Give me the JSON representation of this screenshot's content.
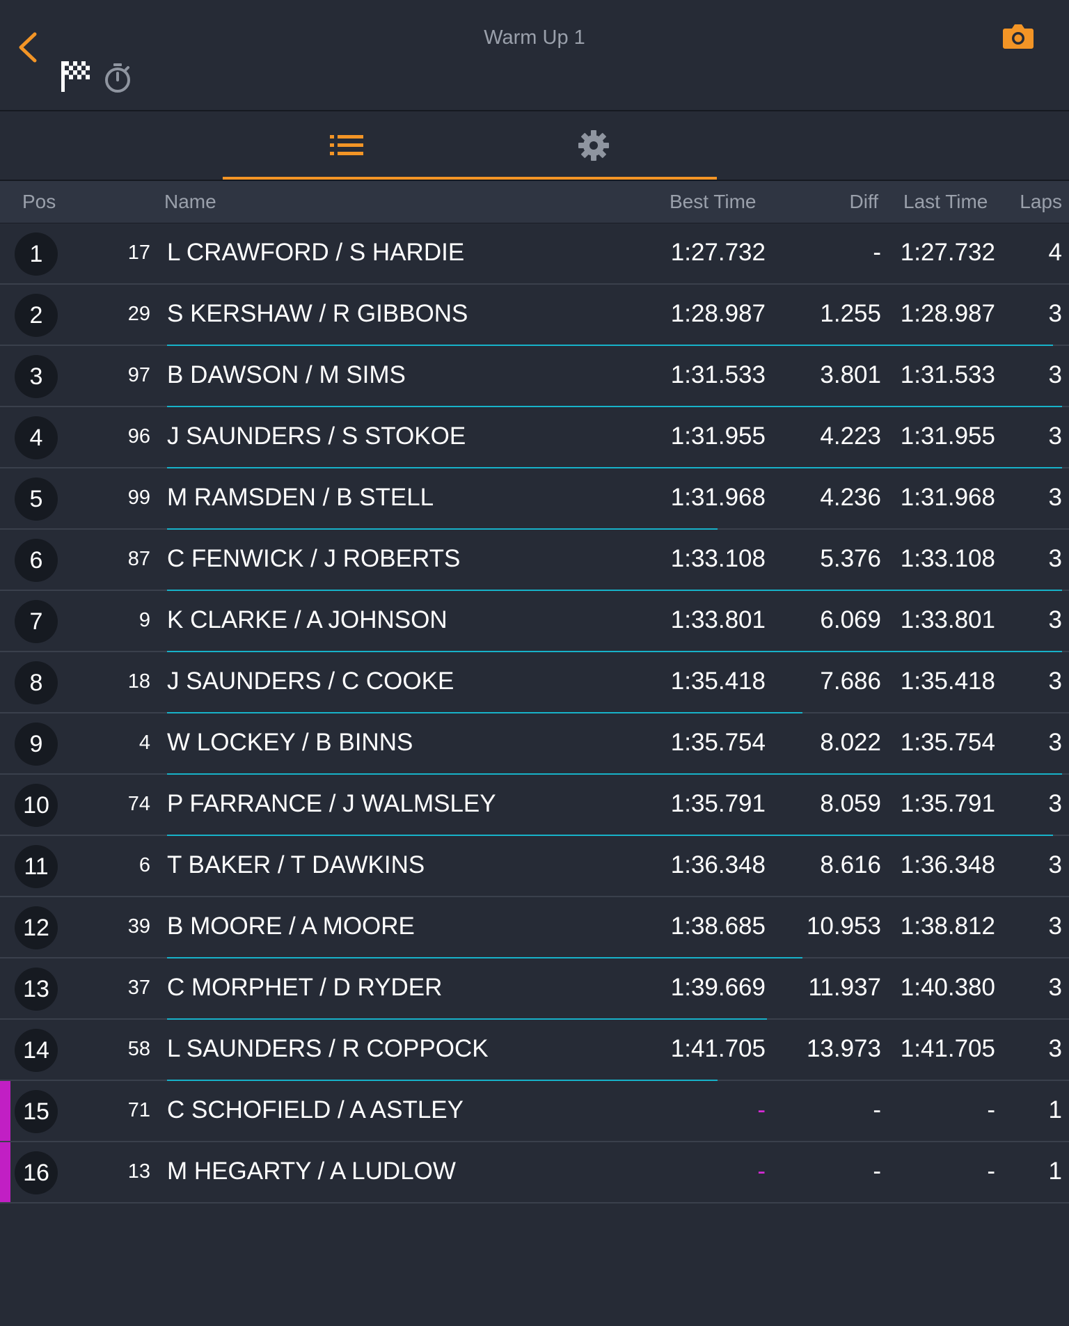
{
  "header": {
    "title": "Warm Up 1",
    "back_icon": "chevron-left-icon",
    "flag_icon": "checkered-flag-icon",
    "stopwatch_icon": "stopwatch-icon",
    "camera_icon": "camera-icon"
  },
  "tabs": [
    {
      "icon": "list-icon",
      "active": true
    },
    {
      "icon": "gear-icon",
      "active": false
    }
  ],
  "columns": {
    "pos": "Pos",
    "name": "Name",
    "best": "Best Time",
    "diff": "Diff",
    "last": "Last Time",
    "laps": "Laps"
  },
  "colors": {
    "accent": "#f39526",
    "progress": "#17b2c9",
    "no_time": "#c11fc4",
    "background": "#262b36"
  },
  "rows": [
    {
      "pos": "1",
      "num": "17",
      "name": "L CRAWFORD / S HARDIE",
      "best": "1:27.732",
      "diff": "-",
      "last": "1:27.732",
      "laps": "4",
      "progress": 0,
      "no_time": false
    },
    {
      "pos": "2",
      "num": "29",
      "name": "S KERSHAW / R GIBBONS",
      "best": "1:28.987",
      "diff": "1.255",
      "last": "1:28.987",
      "laps": "3",
      "progress": 0.99,
      "no_time": false
    },
    {
      "pos": "3",
      "num": "97",
      "name": "B DAWSON / M SIMS",
      "best": "1:31.533",
      "diff": "3.801",
      "last": "1:31.533",
      "laps": "3",
      "progress": 1.0,
      "no_time": false
    },
    {
      "pos": "4",
      "num": "96",
      "name": "J SAUNDERS / S STOKOE",
      "best": "1:31.955",
      "diff": "4.223",
      "last": "1:31.955",
      "laps": "3",
      "progress": 1.0,
      "no_time": false
    },
    {
      "pos": "5",
      "num": "99",
      "name": "M RAMSDEN / B STELL",
      "best": "1:31.968",
      "diff": "4.236",
      "last": "1:31.968",
      "laps": "3",
      "progress": 0.615,
      "no_time": false
    },
    {
      "pos": "6",
      "num": "87",
      "name": "C FENWICK / J ROBERTS",
      "best": "1:33.108",
      "diff": "5.376",
      "last": "1:33.108",
      "laps": "3",
      "progress": 1.0,
      "no_time": false
    },
    {
      "pos": "7",
      "num": "9",
      "name": "K CLARKE / A JOHNSON",
      "best": "1:33.801",
      "diff": "6.069",
      "last": "1:33.801",
      "laps": "3",
      "progress": 1.0,
      "no_time": false
    },
    {
      "pos": "8",
      "num": "18",
      "name": "J SAUNDERS / C COOKE",
      "best": "1:35.418",
      "diff": "7.686",
      "last": "1:35.418",
      "laps": "3",
      "progress": 0.71,
      "no_time": false
    },
    {
      "pos": "9",
      "num": "4",
      "name": "W LOCKEY / B BINNS",
      "best": "1:35.754",
      "diff": "8.022",
      "last": "1:35.754",
      "laps": "3",
      "progress": 1.0,
      "no_time": false
    },
    {
      "pos": "10",
      "num": "74",
      "name": "P FARRANCE / J WALMSLEY",
      "best": "1:35.791",
      "diff": "8.059",
      "last": "1:35.791",
      "laps": "3",
      "progress": 0.99,
      "no_time": false
    },
    {
      "pos": "11",
      "num": "6",
      "name": "T BAKER / T DAWKINS",
      "best": "1:36.348",
      "diff": "8.616",
      "last": "1:36.348",
      "laps": "3",
      "progress": 0,
      "no_time": false
    },
    {
      "pos": "12",
      "num": "39",
      "name": "B MOORE / A MOORE",
      "best": "1:38.685",
      "diff": "10.953",
      "last": "1:38.812",
      "laps": "3",
      "progress": 0.71,
      "no_time": false
    },
    {
      "pos": "13",
      "num": "37",
      "name": "C MORPHET / D RYDER",
      "best": "1:39.669",
      "diff": "11.937",
      "last": "1:40.380",
      "laps": "3",
      "progress": 0.67,
      "no_time": false
    },
    {
      "pos": "14",
      "num": "58",
      "name": "L SAUNDERS / R COPPOCK",
      "best": "1:41.705",
      "diff": "13.973",
      "last": "1:41.705",
      "laps": "3",
      "progress": 0.615,
      "no_time": false
    },
    {
      "pos": "15",
      "num": "71",
      "name": "C SCHOFIELD / A ASTLEY",
      "best": "-",
      "diff": "-",
      "last": "-",
      "laps": "1",
      "progress": 0,
      "no_time": true
    },
    {
      "pos": "16",
      "num": "13",
      "name": "M HEGARTY / A LUDLOW",
      "best": "-",
      "diff": "-",
      "last": "-",
      "laps": "1",
      "progress": 0,
      "no_time": true
    }
  ]
}
